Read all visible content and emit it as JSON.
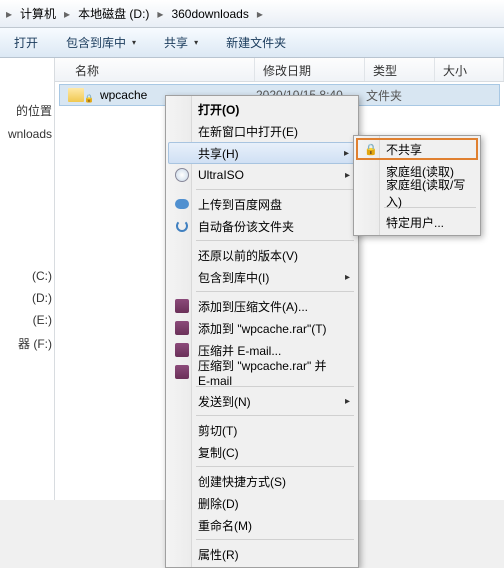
{
  "breadcrumb": {
    "items": [
      "计算机",
      "本地磁盘 (D:)",
      "360downloads"
    ]
  },
  "toolbar": {
    "open": "打开",
    "include": "包含到库中",
    "share": "共享",
    "newfolder": "新建文件夹"
  },
  "columns": {
    "name": "名称",
    "date": "修改日期",
    "type": "类型",
    "size": "大小"
  },
  "file": {
    "name": "wpcache",
    "date": "2020/10/15 8:40",
    "type": "文件夹"
  },
  "sidebar": {
    "locations": "的位置",
    "downloads": "wnloads",
    "drives": [
      "(C:)",
      "(D:)",
      "(E:)",
      "器 (F:)"
    ]
  },
  "menu": {
    "open": "打开(O)",
    "open_new": "在新窗口中打开(E)",
    "share": "共享(H)",
    "ultraiso": "UltraISO",
    "upload_baidu": "上传到百度网盘",
    "auto_backup": "自动备份该文件夹",
    "restore": "还原以前的版本(V)",
    "include_lib": "包含到库中(I)",
    "add_archive": "添加到压缩文件(A)...",
    "add_wpcache": "添加到 \"wpcache.rar\"(T)",
    "compress_email": "压缩并 E-mail...",
    "compress_wpcache_email": "压缩到 \"wpcache.rar\" 并 E-mail",
    "send_to": "发送到(N)",
    "cut": "剪切(T)",
    "copy": "复制(C)",
    "shortcut": "创建快捷方式(S)",
    "delete": "删除(D)",
    "rename": "重命名(M)",
    "properties": "属性(R)"
  },
  "submenu": {
    "no_share": "不共享",
    "homegroup_read": "家庭组(读取)",
    "homegroup_rw": "家庭组(读取/写入)",
    "specific_user": "特定用户..."
  }
}
